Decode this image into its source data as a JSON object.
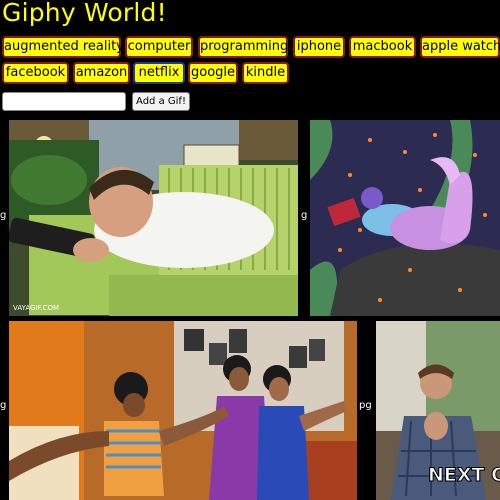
{
  "app": {
    "title": "Giphy World!"
  },
  "topics": [
    {
      "label": "augmented reality",
      "selected": false
    },
    {
      "label": "computer",
      "selected": false
    },
    {
      "label": "programming",
      "selected": false
    },
    {
      "label": "iphone",
      "selected": false
    },
    {
      "label": "macbook",
      "selected": false
    },
    {
      "label": "apple watch",
      "selected": false
    },
    {
      "label": "facebook",
      "selected": false
    },
    {
      "label": "amazon",
      "selected": false
    },
    {
      "label": "netflix",
      "selected": true
    },
    {
      "label": "google",
      "selected": false
    },
    {
      "label": "kindle",
      "selected": false
    }
  ],
  "form": {
    "input_value": "",
    "add_label": "Add a Gif!"
  },
  "gifs": [
    {
      "rating": "g",
      "watermark": "VAYAGIF.COM",
      "overlay_text": ""
    },
    {
      "rating": "g",
      "watermark": "",
      "overlay_text": ""
    },
    {
      "rating": "g",
      "watermark": "",
      "overlay_text": ""
    },
    {
      "rating": "pg",
      "watermark": "",
      "overlay_text": "NEXT OI"
    }
  ],
  "colors": {
    "background": "#000000",
    "accent": "#ffff00",
    "button_border": "#8b1a1a",
    "selected_border": "#1a3a9e"
  }
}
